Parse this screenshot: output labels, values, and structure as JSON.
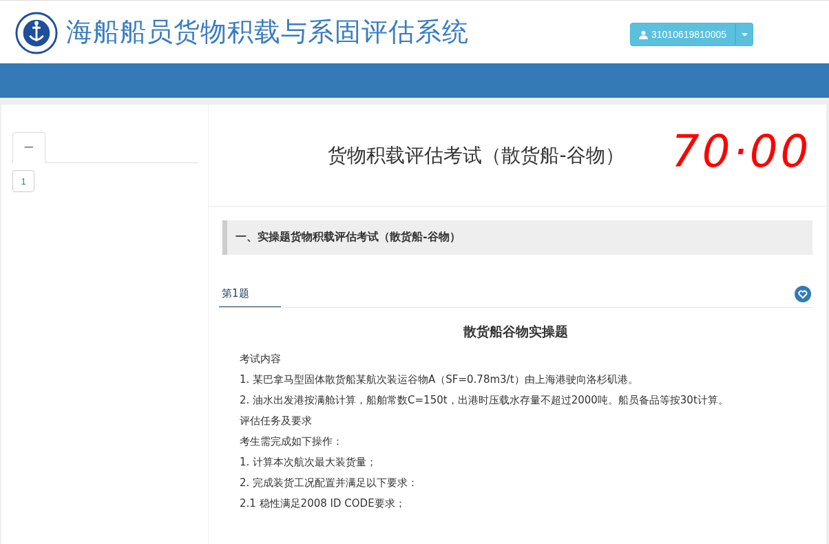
{
  "header": {
    "title": "海船船员货物积载与系固评估系统",
    "user_button": "31010619810005"
  },
  "sidebar": {
    "tabs": [
      {
        "label": "一",
        "selected": true
      }
    ],
    "question_numbers": [
      "1"
    ]
  },
  "exam": {
    "title": "货物积载评估考试（散货船-谷物）",
    "score_mark": "70·00",
    "section_title": "一、实操题货物积载评估考试（散货船-谷物）",
    "question_tab": "第1题",
    "question_heading": "散货船谷物实操题",
    "paragraph_groups": [
      [
        "考试内容"
      ],
      [
        "1. 某巴拿马型固体散货船某航次装运谷物A（SF=0.78m3/t）由上海港驶向洛杉矶港。",
        "2. 油水出发港按满舱计算，船舶常数C=150t，出港时压载水存量不超过2000吨。船员备品等按30t计算。"
      ],
      [
        "评估任务及要求"
      ],
      [
        "考生需完成如下操作：",
        "1. 计算本次航次最大装货量；",
        "2. 完成装货工况配置并满足以下要求：",
        "2.1 稳性满足2008 ID CODE要求；"
      ]
    ]
  }
}
